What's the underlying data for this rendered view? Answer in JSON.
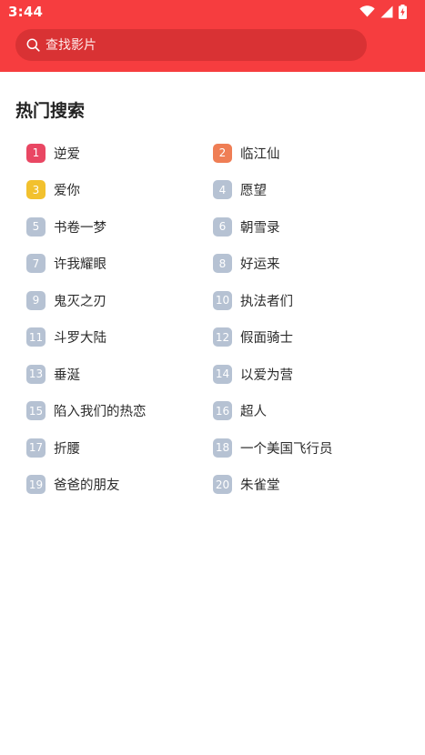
{
  "status_bar": {
    "time": "3:44",
    "icons": [
      "wifi-icon",
      "cell-signal-icon",
      "battery-charging-icon"
    ]
  },
  "search": {
    "placeholder": "查找影片",
    "value": ""
  },
  "hot_search": {
    "title": "热门搜索",
    "items": [
      {
        "rank": "1",
        "title": "逆爱"
      },
      {
        "rank": "2",
        "title": "临江仙"
      },
      {
        "rank": "3",
        "title": "爱你"
      },
      {
        "rank": "4",
        "title": "愿望"
      },
      {
        "rank": "5",
        "title": "书卷一梦"
      },
      {
        "rank": "6",
        "title": "朝雪录"
      },
      {
        "rank": "7",
        "title": "许我耀眼"
      },
      {
        "rank": "8",
        "title": "好运来"
      },
      {
        "rank": "9",
        "title": "鬼灭之刃"
      },
      {
        "rank": "10",
        "title": "执法者们"
      },
      {
        "rank": "11",
        "title": "斗罗大陆"
      },
      {
        "rank": "12",
        "title": "假面骑士"
      },
      {
        "rank": "13",
        "title": "垂涎"
      },
      {
        "rank": "14",
        "title": "以爱为营"
      },
      {
        "rank": "15",
        "title": "陷入我们的热恋"
      },
      {
        "rank": "16",
        "title": "超人"
      },
      {
        "rank": "17",
        "title": "折腰"
      },
      {
        "rank": "18",
        "title": "一个美国飞行员"
      },
      {
        "rank": "19",
        "title": "爸爸的朋友"
      },
      {
        "rank": "20",
        "title": "朱雀堂"
      }
    ]
  },
  "colors": {
    "header": "#f63d3f",
    "search_bg": "#d93234",
    "rank_1": "#e94763",
    "rank_2": "#ef7e55",
    "rank_3": "#f2c12e",
    "rank_default": "#b6c2d3"
  }
}
